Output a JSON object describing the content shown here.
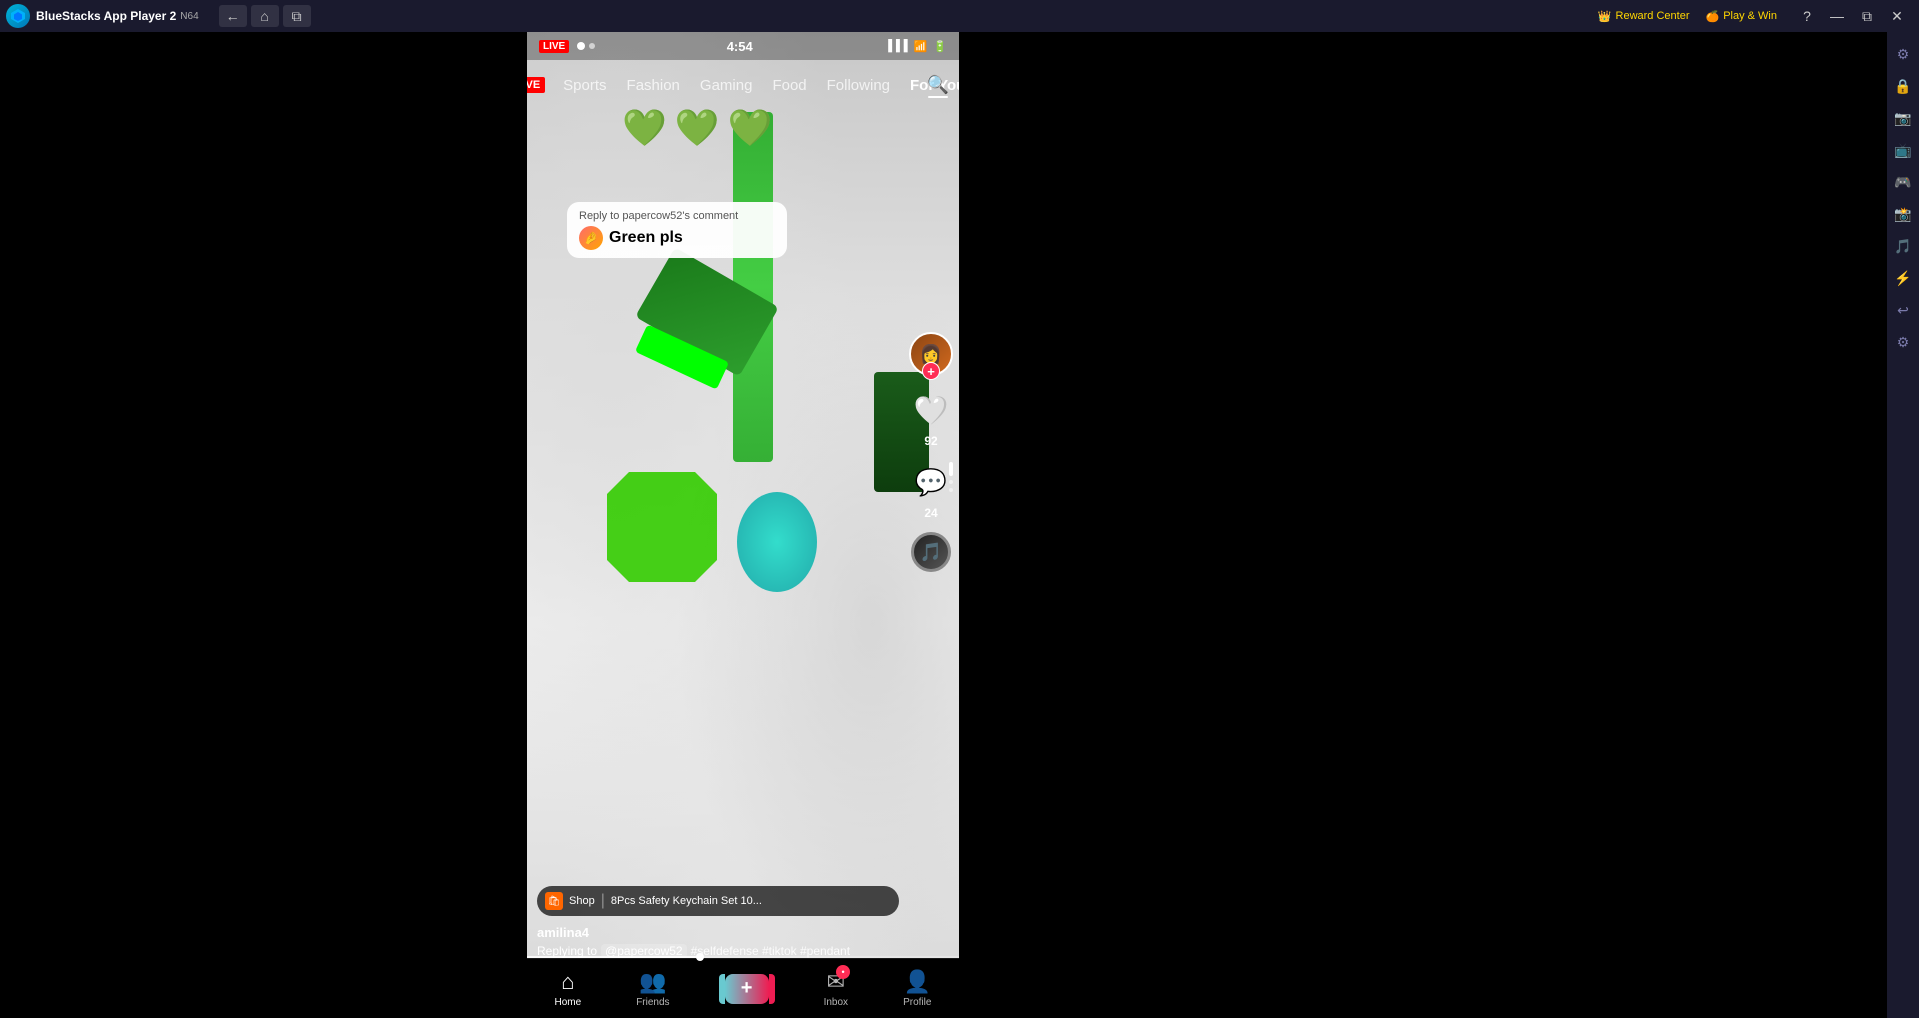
{
  "titlebar": {
    "app_name": "BlueStacks App Player 2",
    "sub": "N64",
    "nav_back": "←",
    "nav_home": "⌂",
    "nav_multi": "⧉",
    "reward_label": "Reward Center",
    "play_win_label": "Play & Win",
    "btn_help": "?",
    "btn_minimize": "—",
    "btn_restore": "⧉",
    "btn_close": "✕"
  },
  "phone": {
    "status_time": "4:54",
    "tiktok": {
      "nav_items": [
        {
          "label": "LIVE",
          "active": false,
          "is_live": true
        },
        {
          "label": "Sports",
          "active": false
        },
        {
          "label": "Fashion",
          "active": false
        },
        {
          "label": "Gaming",
          "active": false
        },
        {
          "label": "Food",
          "active": false
        },
        {
          "label": "Following",
          "active": false
        },
        {
          "label": "For You",
          "active": true
        }
      ],
      "hearts": "💚💚💚",
      "comment": {
        "reply_to": "Reply to papercow52's comment",
        "emoji": "🤌",
        "text": "Green pls"
      },
      "username": "amilina4",
      "replying_to": "Replying to",
      "mention": "@papercow52",
      "hashtags": "#selfdefense #tiktok #pendant",
      "shop_label": "Shop",
      "shop_divider": "|",
      "shop_product": "8Pcs Safety Keychain Set 10...",
      "action_like_count": "92",
      "action_comment_count": "24",
      "bottom_nav": [
        {
          "label": "Home",
          "icon": "⌂",
          "active": true
        },
        {
          "label": "Friends",
          "icon": "👥",
          "active": false
        },
        {
          "label": "+",
          "icon": "+",
          "active": false,
          "is_plus": true
        },
        {
          "label": "Inbox",
          "icon": "✉",
          "active": false,
          "has_badge": true
        },
        {
          "label": "Profile",
          "icon": "👤",
          "active": false
        }
      ]
    }
  },
  "sidebar_icons": [
    "⚙",
    "🔒",
    "📷",
    "📺",
    "🎮",
    "📸",
    "🎵",
    "⚡",
    "↩",
    "⚙"
  ]
}
